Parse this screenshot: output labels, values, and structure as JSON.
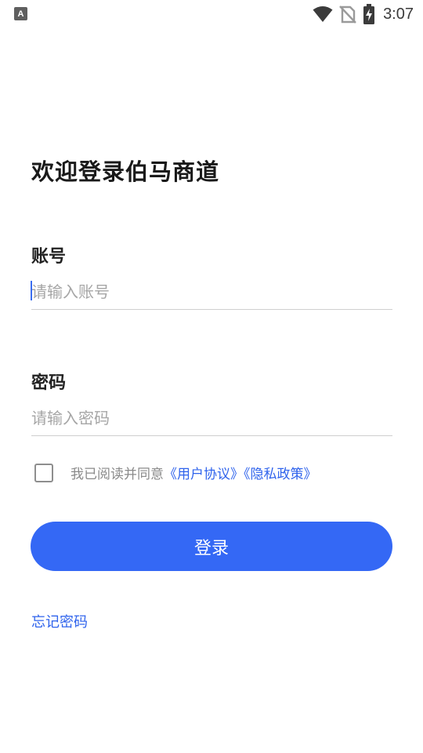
{
  "status_bar": {
    "app_icon_letter": "A",
    "time": "3:07",
    "icons": [
      "wifi-icon",
      "no-sim-icon",
      "battery-charging-icon"
    ]
  },
  "page": {
    "title": "欢迎登录伯马商道"
  },
  "account": {
    "label": "账号",
    "placeholder": "请输入账号",
    "value": ""
  },
  "password": {
    "label": "密码",
    "placeholder": "请输入密码",
    "value": ""
  },
  "agreement": {
    "checked": false,
    "text": "我已阅读并同意",
    "user_agreement": "《用户协议》",
    "privacy_policy": "《隐私政策》"
  },
  "actions": {
    "login_label": "登录",
    "forgot_password": "忘记密码"
  },
  "colors": {
    "accent": "#3468f5",
    "link": "#2f63ec",
    "placeholder": "#a6a6a6"
  }
}
